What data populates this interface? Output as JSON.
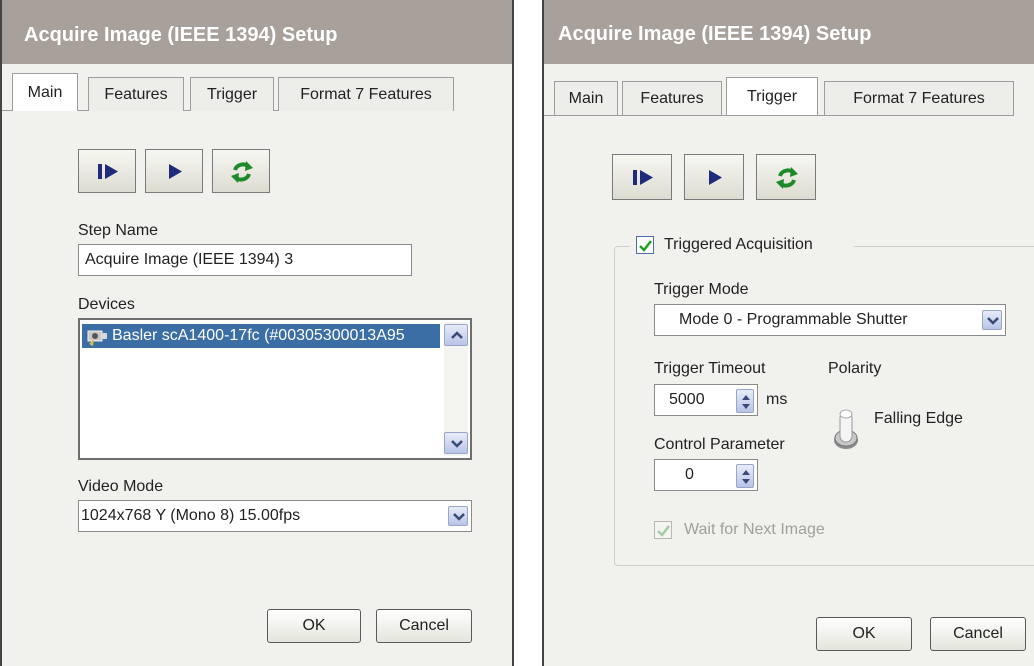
{
  "left_dialog": {
    "title": "Acquire Image (IEEE 1394) Setup",
    "tabs": [
      "Main",
      "Features",
      "Trigger",
      "Format 7 Features"
    ],
    "active_tab": "Main",
    "toolbar": {
      "icons": [
        "step-run-icon",
        "run-icon",
        "refresh-icon"
      ]
    },
    "step_name_label": "Step Name",
    "step_name_value": "Acquire Image (IEEE 1394) 3",
    "devices_label": "Devices",
    "devices": [
      "Basler scA1400-17fc (#00305300013A95"
    ],
    "video_mode_label": "Video Mode",
    "video_mode_value": "1024x768 Y (Mono 8) 15.00fps",
    "ok_label": "OK",
    "cancel_label": "Cancel"
  },
  "right_dialog": {
    "title": "Acquire Image (IEEE 1394) Setup",
    "tabs": [
      "Main",
      "Features",
      "Trigger",
      "Format 7 Features"
    ],
    "active_tab": "Trigger",
    "toolbar": {
      "icons": [
        "step-run-icon",
        "run-icon",
        "refresh-icon"
      ]
    },
    "triggered_acquisition_label": "Triggered Acquisition",
    "triggered_acquisition_checked": true,
    "trigger_mode_label": "Trigger Mode",
    "trigger_mode_value": "Mode 0 - Programmable Shutter",
    "trigger_timeout_label": "Trigger Timeout",
    "trigger_timeout_value": "5000",
    "trigger_timeout_unit": "ms",
    "polarity_label": "Polarity",
    "polarity_value": "Falling Edge",
    "control_parameter_label": "Control Parameter",
    "control_parameter_value": "0",
    "wait_next_image_label": "Wait for Next Image",
    "wait_next_image_checked": true,
    "wait_next_image_enabled": false,
    "ok_label": "OK",
    "cancel_label": "Cancel"
  },
  "colors": {
    "titlebar": "#a8a09a",
    "panel": "#f1f1ed",
    "selection": "#3a6ea5",
    "play_arrow": "#1f2a7a",
    "refresh_green": "#1d8a2a"
  }
}
